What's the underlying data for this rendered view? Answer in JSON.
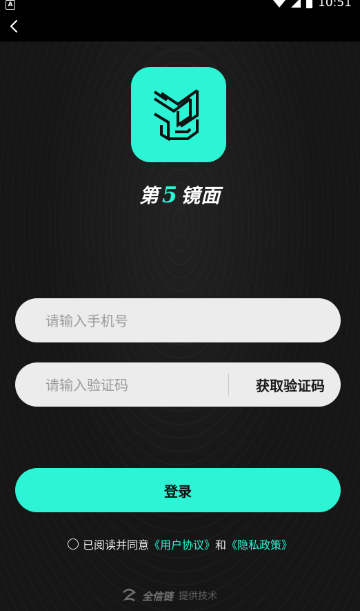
{
  "status_bar": {
    "time": "10:51",
    "left_icon": "A"
  },
  "nav": {
    "back_icon": "chevron-left-icon"
  },
  "brand": {
    "prefix": "第",
    "number": "5",
    "suffix": "镜面"
  },
  "phone_field": {
    "placeholder": "请输入手机号",
    "value": ""
  },
  "code_field": {
    "placeholder": "请输入验证码",
    "value": "",
    "get_code_label": "获取验证码"
  },
  "login": {
    "label": "登录"
  },
  "agreement": {
    "text": "已阅读并同意",
    "user_agreement": "《用户协议》",
    "and": "和",
    "privacy_policy": "《隐私政策》"
  },
  "footer": {
    "logo_text": "全信链",
    "text": "提供技术"
  },
  "colors": {
    "accent": "#2cf4d4",
    "background": "#171717",
    "field_bg": "#ececec"
  }
}
